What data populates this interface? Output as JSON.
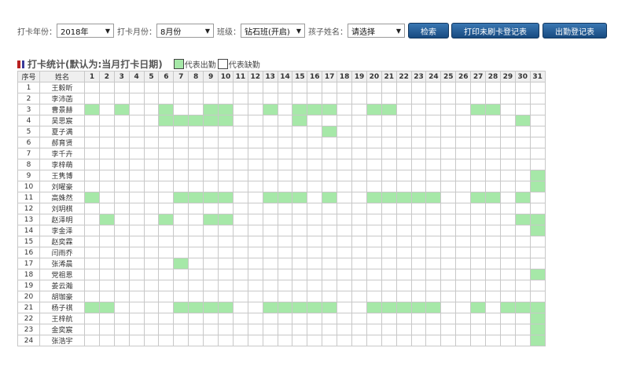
{
  "filters": {
    "year_label": "打卡年份：",
    "year_value": "2018年",
    "month_label": "打卡月份：",
    "month_value": "8月份",
    "class_label": "班级：",
    "class_value": "钻石班(开启)",
    "child_label": "孩子姓名：",
    "child_value": "请选择",
    "search_button": "检索",
    "print_unpunched_button": "打印未刷卡登记表",
    "attendance_register_button": "出勤登记表"
  },
  "title": "打卡统计(默认为:当月打卡日期)",
  "legend": {
    "present_label": "代表出勤",
    "absent_label": "代表缺勤",
    "present_color": "#a6e8a8",
    "absent_color": "#ffffff"
  },
  "table": {
    "col_index": "序号",
    "col_name": "姓名",
    "days": [
      "1",
      "2",
      "3",
      "4",
      "5",
      "6",
      "7",
      "8",
      "9",
      "10",
      "11",
      "12",
      "13",
      "14",
      "15",
      "16",
      "17",
      "18",
      "19",
      "20",
      "21",
      "22",
      "23",
      "24",
      "25",
      "26",
      "27",
      "28",
      "29",
      "30",
      "31"
    ],
    "rows": [
      {
        "index": "1",
        "name": "王毅昕",
        "present": []
      },
      {
        "index": "2",
        "name": "李沛菡",
        "present": []
      },
      {
        "index": "3",
        "name": "曹景赫",
        "present": [
          1,
          3,
          6,
          9,
          10,
          13,
          15,
          16,
          17,
          20,
          21,
          27,
          28
        ]
      },
      {
        "index": "4",
        "name": "吴思宸",
        "present": [
          6,
          7,
          8,
          9,
          10,
          15,
          30
        ]
      },
      {
        "index": "5",
        "name": "夏子满",
        "present": [
          17
        ]
      },
      {
        "index": "6",
        "name": "郝育贤",
        "present": []
      },
      {
        "index": "7",
        "name": "李千卉",
        "present": []
      },
      {
        "index": "8",
        "name": "李梓萌",
        "present": []
      },
      {
        "index": "9",
        "name": "王隽博",
        "present": [
          31
        ]
      },
      {
        "index": "10",
        "name": "刘曜豪",
        "present": [
          31
        ]
      },
      {
        "index": "11",
        "name": "高姝然",
        "present": [
          1,
          7,
          8,
          9,
          10,
          13,
          14,
          15,
          17,
          20,
          21,
          22,
          23,
          24,
          27,
          28,
          30
        ]
      },
      {
        "index": "12",
        "name": "刘玥棋",
        "present": []
      },
      {
        "index": "13",
        "name": "赵泽明",
        "present": [
          2,
          6,
          9,
          10,
          30,
          31
        ]
      },
      {
        "index": "14",
        "name": "李金泽",
        "present": [
          31
        ]
      },
      {
        "index": "15",
        "name": "赵奕霖",
        "present": []
      },
      {
        "index": "16",
        "name": "闫雨乔",
        "present": []
      },
      {
        "index": "17",
        "name": "张浠晨",
        "present": [
          7
        ]
      },
      {
        "index": "18",
        "name": "党祖恩",
        "present": [
          31
        ]
      },
      {
        "index": "19",
        "name": "姜云瀚",
        "present": []
      },
      {
        "index": "20",
        "name": "胡珈豪",
        "present": []
      },
      {
        "index": "21",
        "name": "杨子祺",
        "present": [
          1,
          2,
          7,
          8,
          9,
          10,
          13,
          14,
          15,
          16,
          17,
          20,
          21,
          22,
          23,
          24,
          27,
          29,
          30,
          31
        ]
      },
      {
        "index": "22",
        "name": "王梓航",
        "present": [
          31
        ]
      },
      {
        "index": "23",
        "name": "金奕宸",
        "present": [
          31
        ]
      },
      {
        "index": "24",
        "name": "张浩宇",
        "present": [
          31
        ]
      }
    ]
  }
}
